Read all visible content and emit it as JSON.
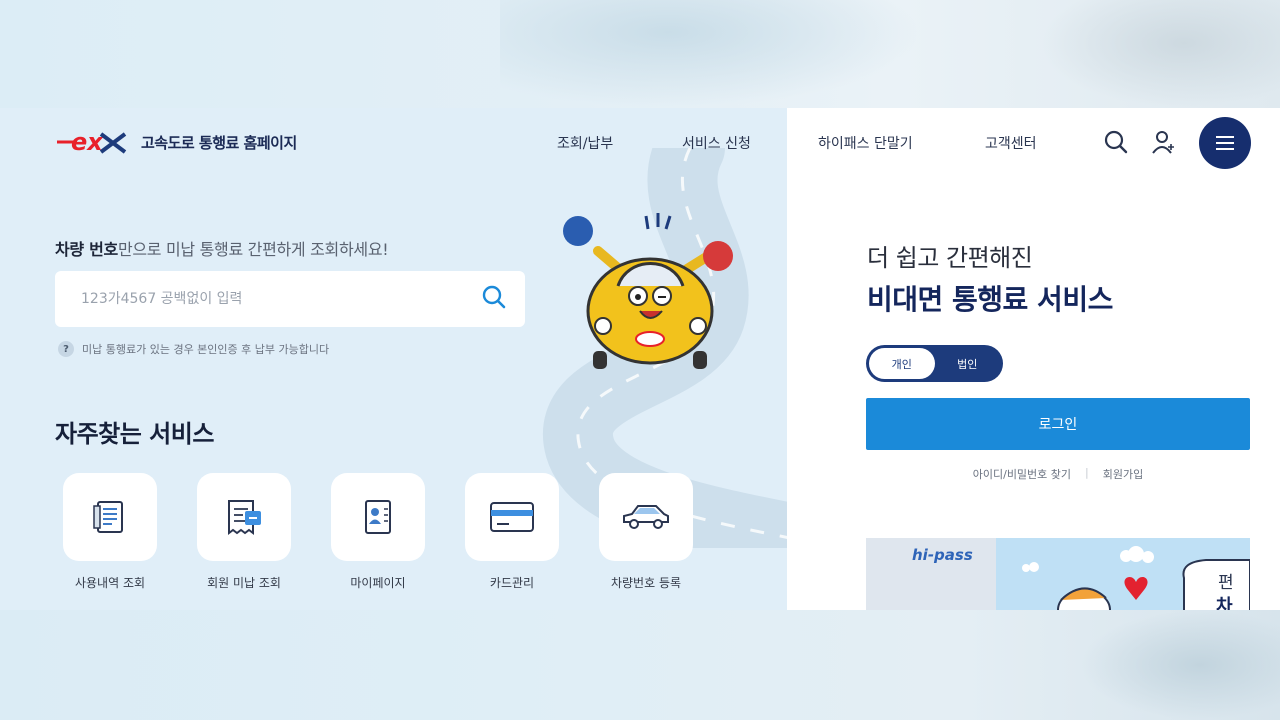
{
  "header": {
    "logo_mark": "ex",
    "site_title": "고속도로 통행료 홈페이지",
    "nav": [
      "조회/납부",
      "서비스 신청",
      "하이패스 단말기",
      "고객센터"
    ],
    "icons": [
      "search-icon",
      "user-icon",
      "menu-icon"
    ]
  },
  "search": {
    "headline_bold": "차량 번호",
    "headline_rest": "만으로 미납 통행료 간편하게 조회하세요!",
    "placeholder": "123가4567 공백없이 입력",
    "hint_icon": "?",
    "hint": "미납 통행료가 있는 경우 본인인증 후 납부 가능합니다"
  },
  "favorites": {
    "title": "자주찾는 서비스",
    "items": [
      {
        "label": "사용내역 조회",
        "icon": "document-list-icon"
      },
      {
        "label": "회원 미납 조회",
        "icon": "receipt-icon"
      },
      {
        "label": "마이페이지",
        "icon": "id-card-icon"
      },
      {
        "label": "카드관리",
        "icon": "credit-card-icon"
      },
      {
        "label": "차량번호 등록",
        "icon": "car-icon"
      }
    ]
  },
  "login": {
    "subtitle": "더 쉽고 간편해진",
    "title": "비대면 통행료 서비스",
    "toggle": {
      "personal": "개인",
      "corporate": "법인"
    },
    "button": "로그인",
    "find_link": "아이디/비밀번호 찾기",
    "join_link": "회원가입"
  },
  "banner": {
    "brand": "hi-pass",
    "text_1": "편",
    "text_2": "차"
  },
  "colors": {
    "brand_red": "#e8202a",
    "navy": "#162e6e",
    "primary_blue": "#1b8ad9",
    "panel_bg": "#e0eef8"
  }
}
